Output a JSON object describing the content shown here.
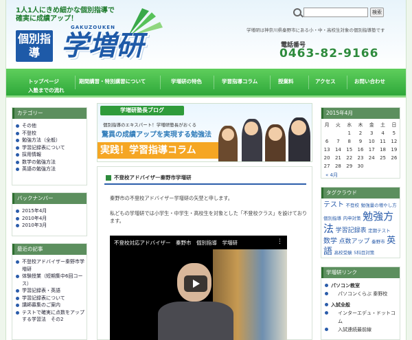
{
  "header": {
    "tagline_1": "1人1人にきめ細かな個別指導で",
    "tagline_2": "確実に成績アップ！",
    "logo_small": "個別指導",
    "logo_roman": "GAKUZOUKEN",
    "logo_big": "学増研",
    "search_button": "検索",
    "search_placeholder": "",
    "description": "学増研は神奈川県秦野市にある小・中・高校生対象の個別指導塾です",
    "phone_label": "電話番号",
    "phone": "0463-82-9166"
  },
  "nav": {
    "items": [
      "トップページ",
      "期間講習・特別講習について",
      "学増研の特色",
      "学習指導コラム",
      "授業料",
      "アクセス",
      "お問い合わせ"
    ],
    "second_row": "入塾までの流れ"
  },
  "left_sidebar": {
    "categories_title": "カテゴリー",
    "categories": [
      "その他",
      "不登校",
      "勉強方法（全般）",
      "学習記録表について",
      "採用情報",
      "数学の勉強方法",
      "英語の勉強方法"
    ],
    "backnumber_title": "バックナンバー",
    "backnumbers": [
      "2015年4月",
      "2010年4月",
      "2010年3月"
    ],
    "recent_title": "最近の記事",
    "recent": [
      "不登校アドバイザー秦野市学増研",
      "体験授業（短期集中6回コース）",
      "学習記録表・英語",
      "学習記録表について",
      "講師募集のご案内",
      "テストで確実に点数をアップする学習法　その2"
    ]
  },
  "banner": {
    "tag": "学増研塾長ブログ",
    "sub": "個別指導のエキスパート！学増研塾長がおくる",
    "main": "驚異の成績アップを実現する勉強法",
    "title": "実践！学習指導コラム"
  },
  "post": {
    "title": "不登校アドバイザー秦野市学増研",
    "p1": "秦野市の不登校アドバイザー学増研の矢埜と申します。",
    "p2": "私どもの学増研では小学生・中学生・高校生を対象とした「不登校クラス」を設けております。",
    "video_title": "不登校対応アドバイザー　秦野市　個別指導　学増研"
  },
  "calendar": {
    "title": "2015年4月",
    "days": [
      "月",
      "火",
      "水",
      "木",
      "金",
      "土",
      "日"
    ],
    "weeks": [
      [
        "",
        "",
        "1",
        "2",
        "3",
        "4",
        "5"
      ],
      [
        "6",
        "7",
        "8",
        "9",
        "10",
        "11",
        "12"
      ],
      [
        "13",
        "14",
        "15",
        "16",
        "17",
        "18",
        "19"
      ],
      [
        "20",
        "21",
        "22",
        "23",
        "24",
        "25",
        "26"
      ],
      [
        "27",
        "28",
        "29",
        "30",
        "",
        "",
        ""
      ]
    ],
    "prev": "« 4月"
  },
  "tag_cloud": {
    "title": "タグクラウド",
    "tags": [
      {
        "text": "テスト",
        "size": 10
      },
      {
        "text": "不登校",
        "size": 6.5
      },
      {
        "text": "勉強量の増やし方",
        "size": 6.5
      },
      {
        "text": "個別指導",
        "size": 6.5
      },
      {
        "text": "内申対策",
        "size": 6.5
      },
      {
        "text": "勉強方法",
        "size": 15
      },
      {
        "text": "学習記録表",
        "size": 9
      },
      {
        "text": "定期テスト",
        "size": 6.5
      },
      {
        "text": "数学",
        "size": 10
      },
      {
        "text": "点数アップ",
        "size": 9
      },
      {
        "text": "秦野市",
        "size": 6.5
      },
      {
        "text": "英語",
        "size": 13
      },
      {
        "text": "高校受験",
        "size": 6.5
      },
      {
        "text": "5科目対策",
        "size": 6.5
      }
    ]
  },
  "links": {
    "title": "学増研リンク",
    "group1": "パソコン教室",
    "group1_item": "パソコンくらぶ 秦野校",
    "group2": "入試全般",
    "group2_item": "インターエデュ・ドットコム",
    "group2_item2": "入試連続最前線"
  },
  "colors": {
    "nav_green": "#2ea83a",
    "brand_blue": "#1e5aa8",
    "accent_orange": "#f5a623"
  }
}
